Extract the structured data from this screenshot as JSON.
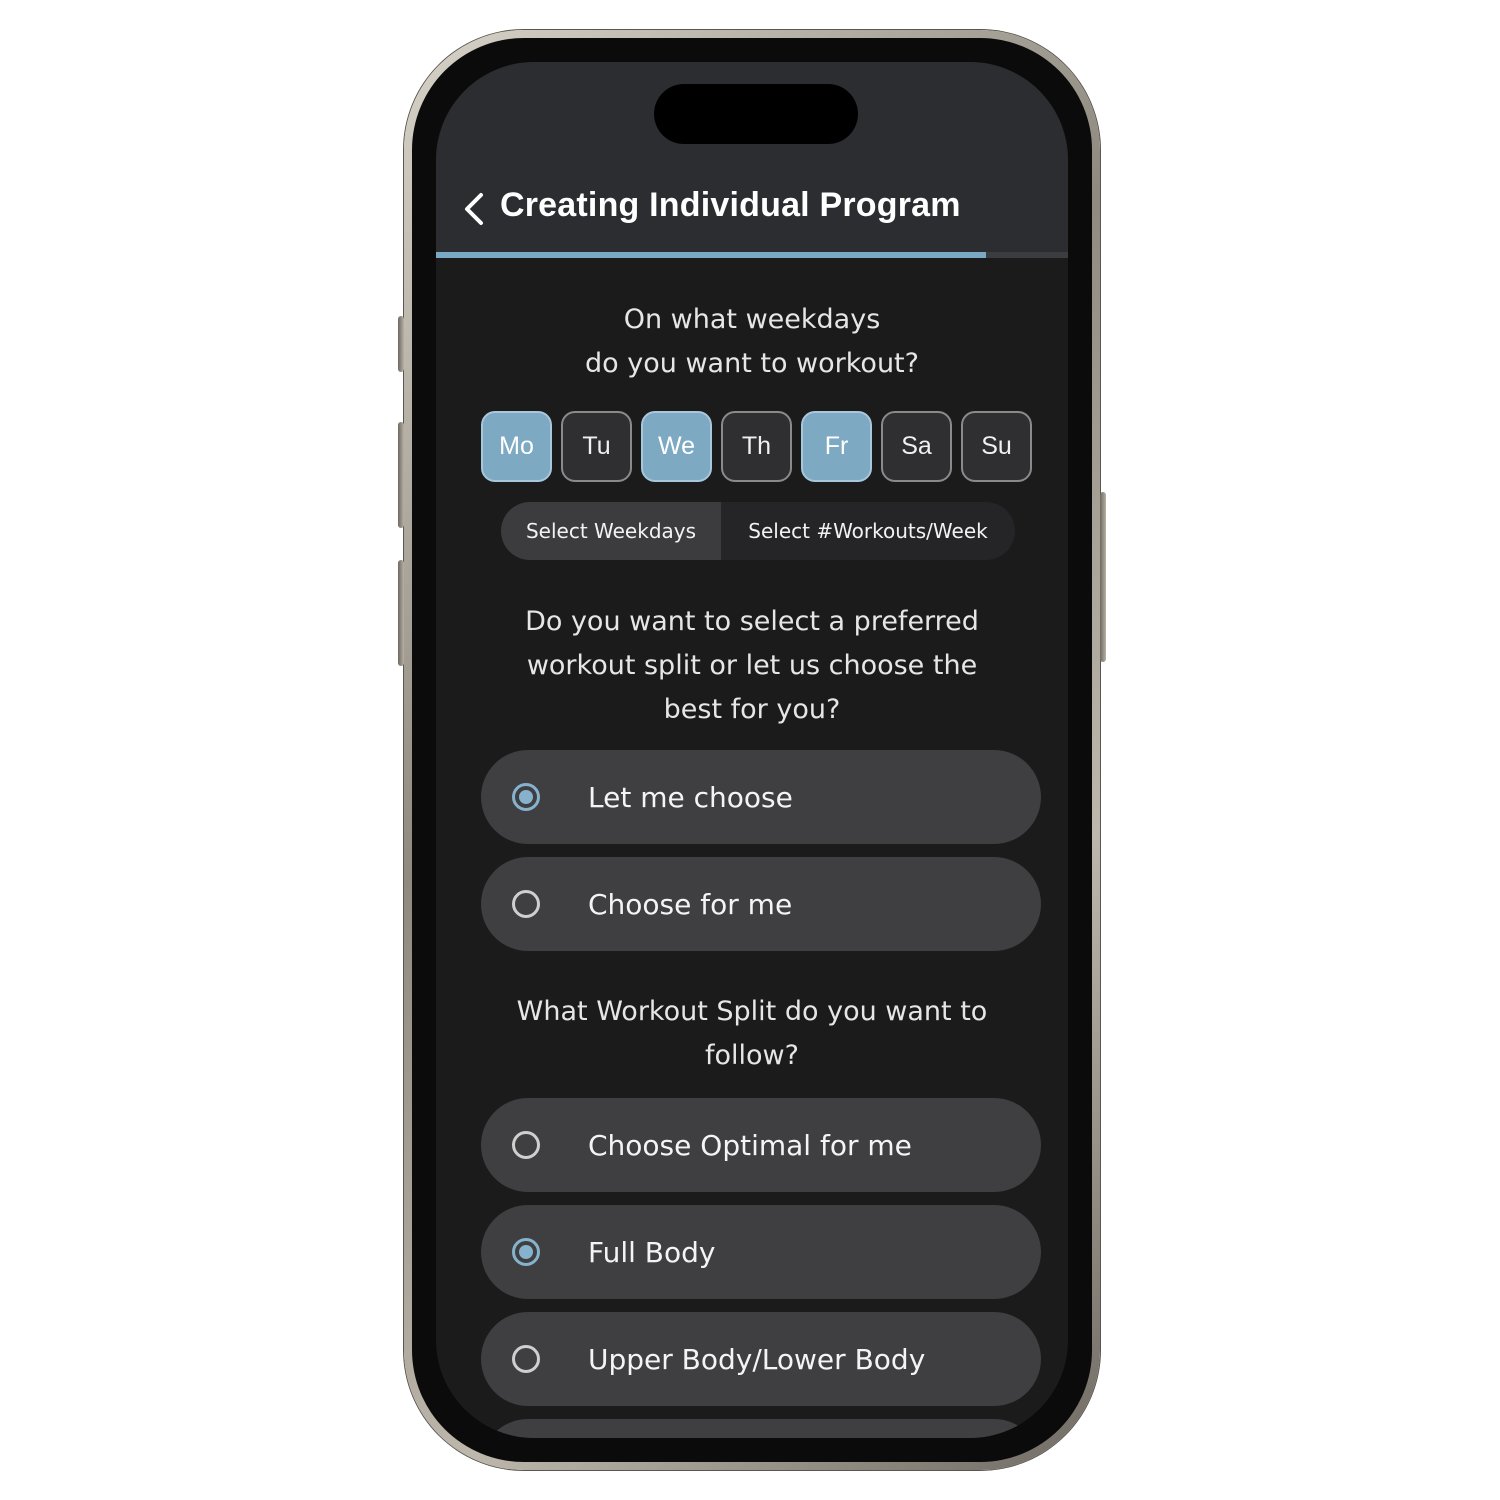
{
  "header": {
    "title": "Creating Individual Program",
    "progress": 0.87
  },
  "colors": {
    "accent": "#7ea9c3",
    "background": "#1b1b1c",
    "header": "#2b2d31",
    "option": "#3f3f41"
  },
  "weekday_question": {
    "line1": "On what weekdays",
    "line2": "do you want to workout?"
  },
  "days": [
    {
      "label": "Mo",
      "selected": true
    },
    {
      "label": "Tu",
      "selected": false
    },
    {
      "label": "We",
      "selected": true
    },
    {
      "label": "Th",
      "selected": false
    },
    {
      "label": "Fr",
      "selected": true
    },
    {
      "label": "Sa",
      "selected": false
    },
    {
      "label": "Su",
      "selected": false
    }
  ],
  "segmented": {
    "option1": "Select Weekdays",
    "option2": "Select #Workouts/Week",
    "active": "option1"
  },
  "split_question": {
    "line1": "Do you want to select a preferred",
    "line2": "workout split or let us choose the",
    "line3": "best for you?"
  },
  "split_choice": [
    {
      "label": "Let me choose",
      "checked": true
    },
    {
      "label": "Choose for me",
      "checked": false
    }
  ],
  "workout_split_question": {
    "line1": "What Workout Split do you want to",
    "line2": "follow?"
  },
  "workout_split_options": [
    {
      "label": "Choose Optimal for me",
      "checked": false
    },
    {
      "label": "Full Body",
      "checked": true
    },
    {
      "label": "Upper Body/Lower Body",
      "checked": false
    }
  ]
}
